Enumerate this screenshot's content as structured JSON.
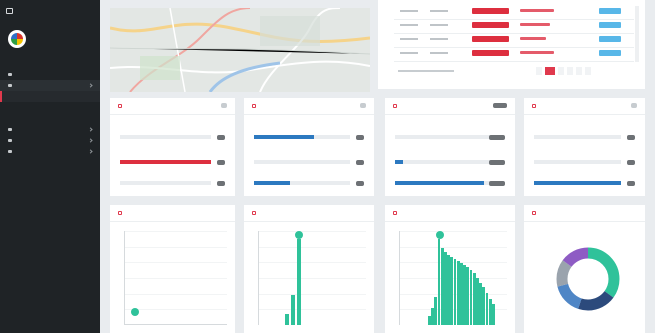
{
  "colors": {
    "accent": "#e0394d",
    "chart": "#2fc29a",
    "blue_bar": "#2c79c0",
    "sidebar": "#1f2326"
  },
  "sidebar": {
    "brand_icon": "monitor-icon",
    "items": [
      {
        "icon": "home-icon"
      },
      {
        "icon": "tasks-icon",
        "active": true,
        "has_children": true
      },
      {
        "sub": true,
        "highlighted": true
      },
      {
        "sub": true
      },
      {
        "sub": true
      },
      {
        "icon": "chart-icon",
        "has_children": true
      },
      {
        "icon": "gear-icon",
        "has_children": true
      },
      {
        "icon": "wrench-icon",
        "has_children": true
      }
    ]
  },
  "cards_row1": [
    {
      "id": "c1",
      "bars": [
        {
          "fill": 0
        },
        {
          "fill": 1.0,
          "color": "#dd2f3f"
        },
        {
          "fill": 0
        }
      ]
    },
    {
      "id": "c2",
      "bars": [
        {
          "fill": 0.63,
          "color": "#2c79c0"
        },
        {
          "fill": 0
        },
        {
          "fill": 0.37,
          "color": "#2c79c0"
        }
      ]
    },
    {
      "id": "c3",
      "bars": [
        {
          "fill": 0
        },
        {
          "fill": 0.08,
          "color": "#2c79c0"
        },
        {
          "fill": 0.93,
          "color": "#2c79c0"
        }
      ]
    },
    {
      "id": "c4",
      "bars": [
        {
          "fill": 0
        },
        {
          "fill": 0
        },
        {
          "fill": 1.0,
          "color": "#2c79c0"
        }
      ]
    }
  ],
  "chart_data": [
    {
      "type": "scatter",
      "series": [
        {
          "values": [
            0.1
          ]
        }
      ]
    },
    {
      "type": "bar",
      "values": [
        0.12,
        0.32,
        0.92
      ],
      "peak_index": 2
    },
    {
      "type": "bar",
      "values": [
        0.1,
        0.18,
        0.3,
        0.92,
        0.82,
        0.78,
        0.74,
        0.72,
        0.7,
        0.68,
        0.66,
        0.64,
        0.62,
        0.58,
        0.55,
        0.5,
        0.45,
        0.4,
        0.34,
        0.28,
        0.22
      ]
    },
    {
      "type": "pie",
      "series": [
        {
          "value": 0.35,
          "color": "#2fc29a"
        },
        {
          "value": 0.2,
          "color": "#2c4a7c"
        },
        {
          "value": 0.16,
          "color": "#4f86c6"
        },
        {
          "value": 0.14,
          "color": "#9aa3ad"
        },
        {
          "value": 0.15,
          "color": "#8e5cc4"
        }
      ]
    }
  ]
}
